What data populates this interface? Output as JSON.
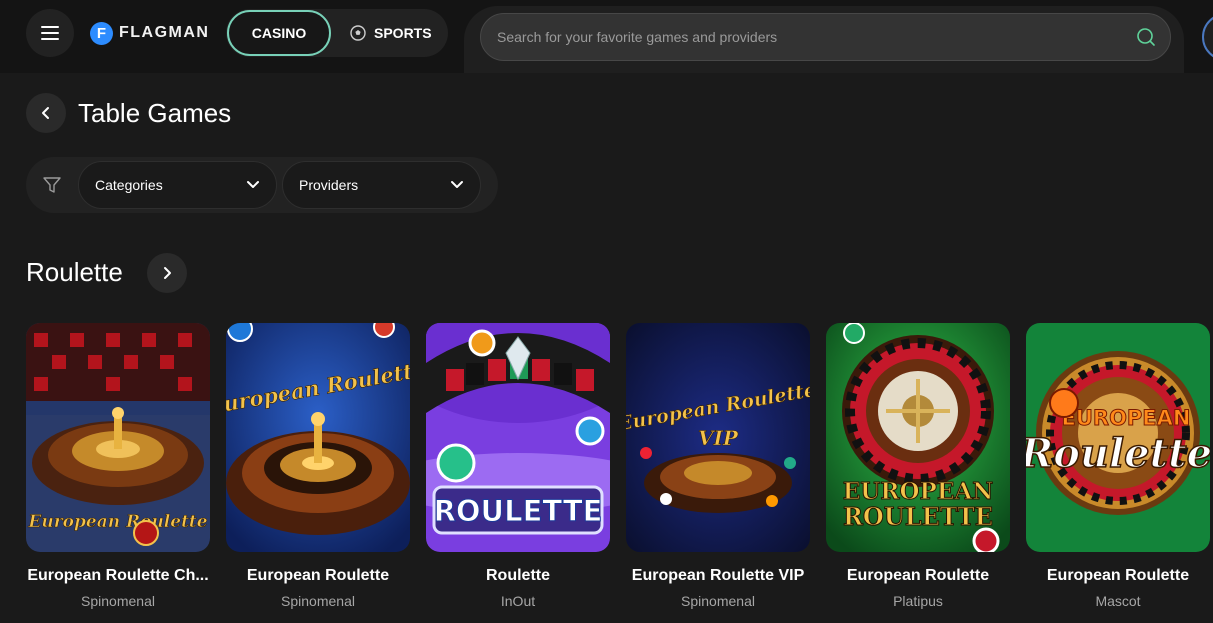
{
  "header": {
    "logo_text": "FLAGMAN",
    "logo_mark": "F",
    "casino_label": "CASINO",
    "sports_label": "SPORTS",
    "search_placeholder": "Search for your favorite games and providers"
  },
  "page": {
    "title": "Table Games"
  },
  "filters": {
    "categories_label": "Categories",
    "providers_label": "Providers"
  },
  "section": {
    "title": "Roulette"
  },
  "games": [
    {
      "name": "European Roulette Ch...",
      "provider": "Spinomenal"
    },
    {
      "name": "European Roulette",
      "provider": "Spinomenal"
    },
    {
      "name": "Roulette",
      "provider": "InOut"
    },
    {
      "name": "European Roulette VIP",
      "provider": "Spinomenal"
    },
    {
      "name": "European Roulette",
      "provider": "Platipus"
    },
    {
      "name": "European Roulette",
      "provider": "Mascot"
    }
  ],
  "thumb_text": {
    "g1": "European Roulette",
    "g2": "European Roulette",
    "g3": "ROULETTE",
    "g4_a": "European Roulette",
    "g4_b": "VIP",
    "g5_a": "EUROPEAN",
    "g5_b": "ROULETTE",
    "g6_a": "EUROPEAN",
    "g6_b": "Roulette"
  },
  "colors": {
    "accent_border": "#78d1b8",
    "brand_blue": "#2d8cff",
    "background": "#1a1a1a"
  },
  "icons": [
    "hamburger-icon",
    "soccer-ball-icon",
    "search-icon",
    "chevron-left-icon",
    "filter-icon",
    "chevron-down-icon",
    "chevron-right-icon"
  ]
}
